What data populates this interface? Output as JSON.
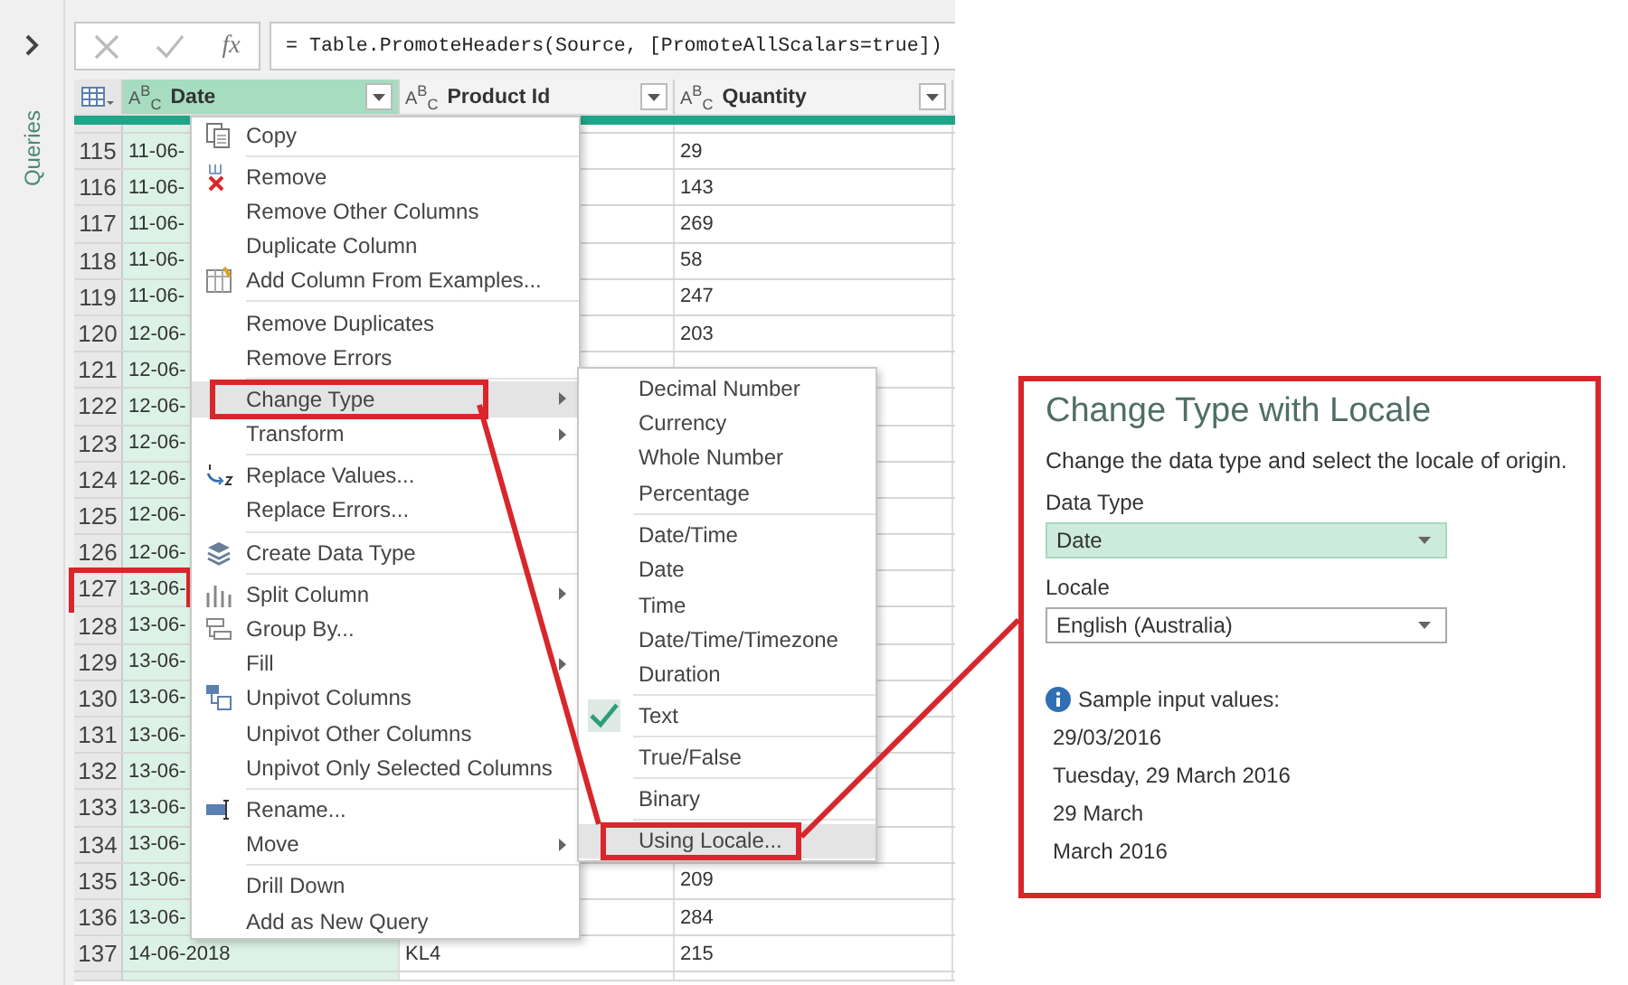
{
  "sidebar": {
    "label": "Queries"
  },
  "formula_bar": {
    "fx": "fx",
    "formula": "= Table.PromoteHeaders(Source, [PromoteAllScalars=true])"
  },
  "table": {
    "columns": [
      {
        "type_label": "A$^{B}$$_{C}$",
        "name": "Date",
        "selected": true
      },
      {
        "type_label": "A$^{B}$$_{C}$",
        "name": "Product Id",
        "selected": false
      },
      {
        "type_label": "A$^{B}$$_{C}$",
        "name": "Quantity",
        "selected": false
      }
    ],
    "rows": [
      {
        "number": "115",
        "date": "11-06-",
        "quantity": "29",
        "highlighted": false
      },
      {
        "number": "116",
        "date": "11-06-",
        "quantity": "143",
        "highlighted": false
      },
      {
        "number": "117",
        "date": "11-06-",
        "quantity": "269",
        "highlighted": false
      },
      {
        "number": "118",
        "date": "11-06-",
        "quantity": "58",
        "highlighted": false
      },
      {
        "number": "119",
        "date": "11-06-",
        "quantity": "247",
        "highlighted": false
      },
      {
        "number": "120",
        "date": "12-06-",
        "quantity": "203",
        "highlighted": false
      },
      {
        "number": "121",
        "date": "12-06-",
        "highlighted": false
      },
      {
        "number": "122",
        "date": "12-06-",
        "highlighted": false
      },
      {
        "number": "123",
        "date": "12-06-",
        "highlighted": false
      },
      {
        "number": "124",
        "date": "12-06-",
        "highlighted": false
      },
      {
        "number": "125",
        "date": "12-06-",
        "highlighted": false
      },
      {
        "number": "126",
        "date": "12-06-",
        "highlighted": false
      },
      {
        "number": "127",
        "date": "13-06-",
        "highlighted": true
      },
      {
        "number": "128",
        "date": "13-06-",
        "highlighted": false
      },
      {
        "number": "129",
        "date": "13-06-",
        "highlighted": false
      },
      {
        "number": "130",
        "date": "13-06-",
        "highlighted": false
      },
      {
        "number": "131",
        "date": "13-06-",
        "highlighted": false
      },
      {
        "number": "132",
        "date": "13-06-",
        "highlighted": false
      },
      {
        "number": "133",
        "date": "13-06-",
        "highlighted": false
      },
      {
        "number": "134",
        "date": "13-06-",
        "highlighted": false
      },
      {
        "number": "135",
        "date": "13-06-",
        "quantity": "209",
        "highlighted": false
      },
      {
        "number": "136",
        "date": "13-06-",
        "quantity": "284",
        "highlighted": false
      },
      {
        "number": "137",
        "date": "14-06-2018",
        "product_id": "KL4",
        "quantity": "215",
        "highlighted": false
      }
    ]
  },
  "context_menu": {
    "groups": [
      [
        {
          "label": "Copy",
          "submenu": false,
          "selected": false,
          "highlighted": false
        }
      ],
      [
        {
          "label": "Remove",
          "submenu": false,
          "selected": false,
          "highlighted": false
        },
        {
          "label": "Remove Other Columns",
          "submenu": false,
          "selected": false,
          "highlighted": false
        },
        {
          "label": "Duplicate Column",
          "submenu": false,
          "selected": false,
          "highlighted": false
        },
        {
          "label": "Add Column From Examples...",
          "submenu": false,
          "selected": false,
          "highlighted": false
        }
      ],
      [
        {
          "label": "Remove Duplicates",
          "submenu": false,
          "selected": false,
          "highlighted": false
        },
        {
          "label": "Remove Errors",
          "submenu": false,
          "selected": false,
          "highlighted": false
        }
      ],
      [
        {
          "label": "Change Type",
          "submenu": true,
          "selected": true,
          "highlighted": true
        },
        {
          "label": "Transform",
          "submenu": true,
          "selected": false,
          "highlighted": false
        }
      ],
      [
        {
          "label": "Replace Values...",
          "submenu": false,
          "selected": false,
          "highlighted": false
        },
        {
          "label": "Replace Errors...",
          "submenu": false,
          "selected": false,
          "highlighted": false
        }
      ],
      [
        {
          "label": "Create Data Type",
          "submenu": false,
          "selected": false,
          "highlighted": false
        }
      ],
      [
        {
          "label": "Split Column",
          "submenu": true,
          "selected": false,
          "highlighted": false
        },
        {
          "label": "Group By...",
          "submenu": false,
          "selected": false,
          "highlighted": false
        },
        {
          "label": "Fill",
          "submenu": true,
          "selected": false,
          "highlighted": false
        },
        {
          "label": "Unpivot Columns",
          "submenu": false,
          "selected": false,
          "highlighted": false
        },
        {
          "label": "Unpivot Other Columns",
          "submenu": false,
          "selected": false,
          "highlighted": false
        },
        {
          "label": "Unpivot Only Selected Columns",
          "submenu": false,
          "selected": false,
          "highlighted": false
        }
      ],
      [
        {
          "label": "Rename...",
          "submenu": false,
          "selected": false,
          "highlighted": false
        },
        {
          "label": "Move",
          "submenu": true,
          "selected": false,
          "highlighted": false
        }
      ],
      [
        {
          "label": "Drill Down",
          "submenu": false,
          "selected": false,
          "highlighted": false
        },
        {
          "label": "Add as New Query",
          "submenu": false,
          "selected": false,
          "highlighted": false
        }
      ]
    ]
  },
  "type_submenu": {
    "groups": [
      [
        {
          "label": "Decimal Number",
          "checked": false,
          "selected": false,
          "highlighted": false
        },
        {
          "label": "Currency",
          "checked": false,
          "selected": false,
          "highlighted": false
        },
        {
          "label": "Whole Number",
          "checked": false,
          "selected": false,
          "highlighted": false
        },
        {
          "label": "Percentage",
          "checked": false,
          "selected": false,
          "highlighted": false
        }
      ],
      [
        {
          "label": "Date/Time",
          "checked": false,
          "selected": false,
          "highlighted": false
        },
        {
          "label": "Date",
          "checked": false,
          "selected": false,
          "highlighted": false
        },
        {
          "label": "Time",
          "checked": false,
          "selected": false,
          "highlighted": false
        },
        {
          "label": "Date/Time/Timezone",
          "checked": false,
          "selected": false,
          "highlighted": false
        },
        {
          "label": "Duration",
          "checked": false,
          "selected": false,
          "highlighted": false
        }
      ],
      [
        {
          "label": "Text",
          "checked": true,
          "selected": false,
          "highlighted": false
        }
      ],
      [
        {
          "label": "True/False",
          "checked": false,
          "selected": false,
          "highlighted": false
        }
      ],
      [
        {
          "label": "Binary",
          "checked": false,
          "selected": false,
          "highlighted": false
        }
      ],
      [
        {
          "label": "Using Locale...",
          "checked": false,
          "selected": true,
          "highlighted": true
        }
      ]
    ]
  },
  "dialog": {
    "title": "Change Type with Locale",
    "description": "Change the data type and select the locale of origin.",
    "highlighted": true,
    "fields": [
      {
        "label": "Data Type",
        "value": "Date",
        "focused": true
      },
      {
        "label": "Locale",
        "value": "English (Australia)",
        "focused": false
      }
    ],
    "info": "Sample input values:",
    "samples": [
      "29/03/2016",
      "Tuesday, 29 March 2016",
      "29 March",
      "March 2016"
    ]
  }
}
